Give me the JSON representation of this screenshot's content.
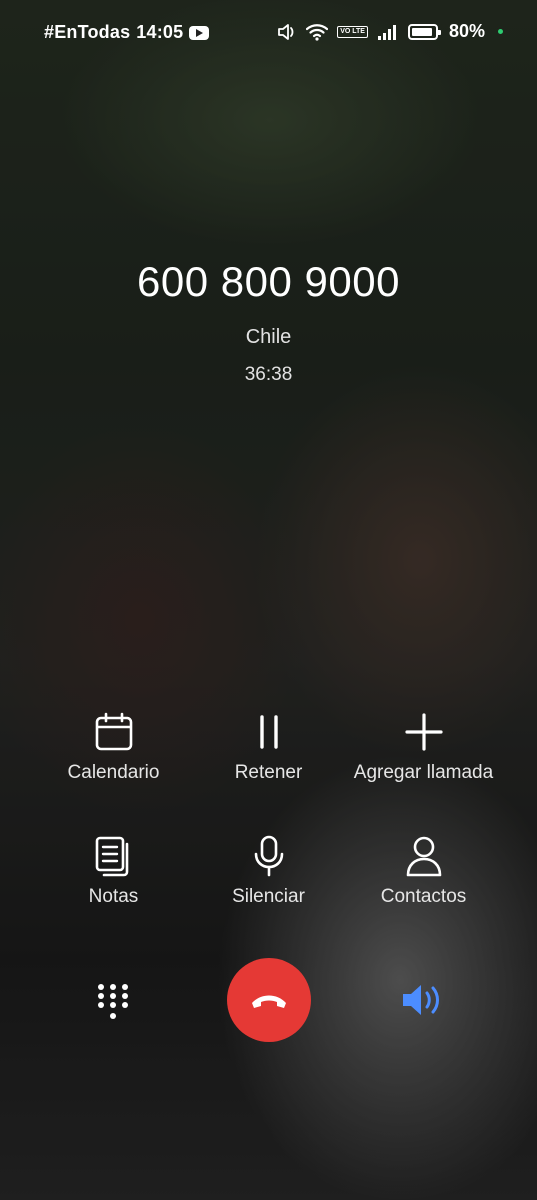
{
  "status_bar": {
    "carrier_text": "#EnTodas",
    "time": "14:05",
    "battery": "80%",
    "volte_label": "VO LTE",
    "icons": [
      "youtube-icon",
      "volume-icon",
      "wifi-icon",
      "volte-icon",
      "signal-icon",
      "battery-icon"
    ]
  },
  "call": {
    "number": "600 800 9000",
    "location": "Chile",
    "duration": "36:38"
  },
  "controls": {
    "calendar": {
      "label": "Calendario",
      "icon": "calendar-icon"
    },
    "hold": {
      "label": "Retener",
      "icon": "pause-icon"
    },
    "add_call": {
      "label": "Agregar llamada",
      "icon": "plus-icon"
    },
    "notes": {
      "label": "Notas",
      "icon": "notes-icon"
    },
    "mute": {
      "label": "Silenciar",
      "icon": "microphone-icon"
    },
    "contacts": {
      "label": "Contactos",
      "icon": "person-icon"
    }
  },
  "bottom": {
    "dialpad_icon": "dialpad-icon",
    "end_call_icon": "end-call-icon",
    "speaker_icon": "speaker-icon"
  },
  "colors": {
    "end_call": "#e53935",
    "speaker_active": "#4c8dff",
    "status_dot": "#2ecc71"
  }
}
